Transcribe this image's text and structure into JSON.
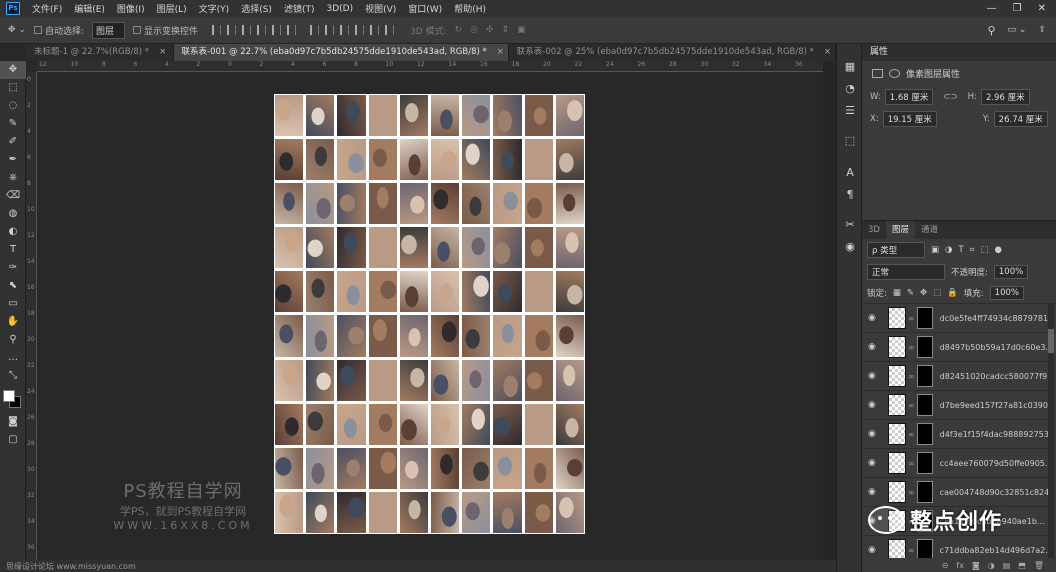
{
  "app": {
    "name": "Ps"
  },
  "menu": [
    "文件(F)",
    "编辑(E)",
    "图像(I)",
    "图层(L)",
    "文字(Y)",
    "选择(S)",
    "滤镜(T)",
    "3D(D)",
    "视图(V)",
    "窗口(W)",
    "帮助(H)"
  ],
  "window_controls": [
    "—",
    "❐",
    "✕"
  ],
  "options": {
    "auto_select_label": "自动选择:",
    "auto_select_value": "图层",
    "transform_label": "显示变换控件",
    "mode_label": "3D 模式:"
  },
  "tabs": [
    {
      "label": "未标题-1 @ 22.7%(RGB/8) *",
      "active": false
    },
    {
      "label": "联系表-001 @ 22.7% (eba0d97c7b5db24575dde1910de543ad, RGB/8) *",
      "active": true
    },
    {
      "label": "联系表-002 @ 25% (eba0d97c7b5db24575dde1910de543ad, RGB/8) *",
      "active": false
    }
  ],
  "tab_close": "×",
  "rulers": {
    "top": [
      "12",
      "10",
      "8",
      "6",
      "4",
      "2",
      "0",
      "2",
      "4",
      "6",
      "8",
      "10",
      "12",
      "14",
      "16",
      "18",
      "20",
      "22",
      "24",
      "26",
      "28",
      "30",
      "32",
      "34",
      "36"
    ],
    "left": [
      "0",
      "2",
      "4",
      "6",
      "8",
      "10",
      "12",
      "14",
      "16",
      "18",
      "20",
      "22",
      "24",
      "26",
      "28",
      "30",
      "32",
      "34",
      "36"
    ]
  },
  "tools": [
    "✥",
    "⬚",
    "◌",
    "✎",
    "✐",
    "✒",
    "⎈",
    "⌫",
    "◍",
    "◐",
    "T",
    "✑",
    "⬉",
    "▭",
    "✋",
    "⚲",
    "…",
    "⤡"
  ],
  "watermark": {
    "line1": "PS教程自学网",
    "line2": "学PS，就到PS教程自学网",
    "line3": "WWW.16XX8.COM"
  },
  "status": {
    "text": "思缘设计论坛 www.missyuan.com"
  },
  "properties": {
    "title": "属性",
    "subtitle": "像素图层属性",
    "w_label": "W:",
    "w_value": "1.68 厘米",
    "h_label": "H:",
    "h_value": "2.96 厘米",
    "x_label": "X:",
    "x_value": "19.15 厘米",
    "y_label": "Y:",
    "y_value": "26.74 厘米"
  },
  "layers": {
    "tabs": [
      "3D",
      "图层",
      "通道"
    ],
    "filter_label": "ρ 类型",
    "blend_mode": "正常",
    "opacity_label": "不透明度:",
    "opacity_value": "100%",
    "lock_label": "锁定:",
    "fill_label": "填充:",
    "fill_value": "100%",
    "items": [
      "dc0e5fe4ff74934c8879781...",
      "d8497b50b59a17d0c60e3...",
      "d82451020cadcc580077f9...",
      "d7be9eed157f27a81c0390...",
      "d4f3e1f15f4dac988892753...",
      "cc4aee760079d50ffe0905...",
      "cae004748d90c32851c824...",
      "c8a11ef0cdb8e940ae1b...",
      "c71ddba82eb14d496d7a2..."
    ],
    "footer_icons": [
      "⊝",
      "fx",
      "◙",
      "◑",
      "▤",
      "⬒",
      "🗑"
    ]
  },
  "brand": {
    "text": "整点创作"
  }
}
